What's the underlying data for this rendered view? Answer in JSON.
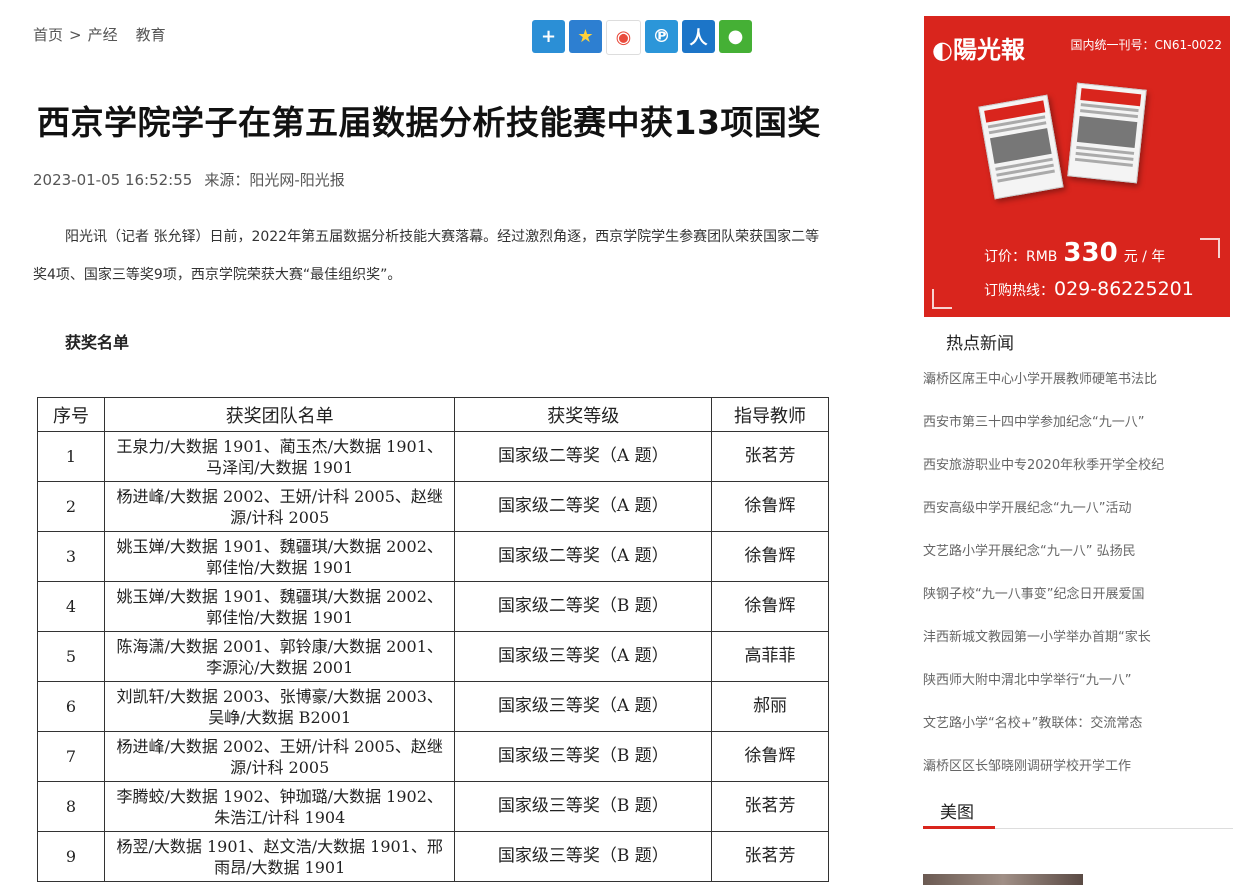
{
  "breadcrumb": {
    "home": "首页",
    "separator": ">",
    "section": "产经",
    "subsection": "教育"
  },
  "share": [
    {
      "icon": "plus-icon",
      "color": "#2b8fd6"
    },
    {
      "icon": "qzone-star-icon",
      "color": "#2d7fd1"
    },
    {
      "icon": "weibo-icon",
      "color": "#e94b3c"
    },
    {
      "icon": "tencent-weibo-icon",
      "color": "#2b96d9"
    },
    {
      "icon": "renren-icon",
      "color": "#1c75c8"
    },
    {
      "icon": "wechat-icon",
      "color": "#45b035"
    }
  ],
  "article": {
    "title": "西京学院学子在第五届数据分析技能赛中获13项国奖",
    "datetime": "2023-01-05 16:52:55",
    "source": "来源：阳光网-阳光报",
    "lead": "阳光讯（记者 张允铎）日前，2022年第五届数据分析技能大赛落幕。经过激烈角逐，西京学院学生参赛团队荣获国家二等奖4项、国家三等奖9项，西京学院荣获大赛“最佳组织奖”。",
    "subheading": "获奖名单"
  },
  "award_table": {
    "headers": [
      "序号",
      "获奖团队名单",
      "获奖等级",
      "指导教师"
    ],
    "rows": [
      {
        "no": "1",
        "team": "王泉力/大数据 1901、蔺玉杰/大数据 1901、马泽闰/大数据 1901",
        "level": "国家级二等奖（A 题）",
        "teacher": "张茗芳"
      },
      {
        "no": "2",
        "team": "杨进峰/大数据 2002、王妍/计科 2005、赵继源/计科 2005",
        "level": "国家级二等奖（A 题）",
        "teacher": "徐鲁辉"
      },
      {
        "no": "3",
        "team": "姚玉婵/大数据 1901、魏疆琪/大数据 2002、郭佳怡/大数据 1901",
        "level": "国家级二等奖（A 题）",
        "teacher": "徐鲁辉"
      },
      {
        "no": "4",
        "team": "姚玉婵/大数据 1901、魏疆琪/大数据 2002、郭佳怡/大数据 1901",
        "level": "国家级二等奖（B 题）",
        "teacher": "徐鲁辉"
      },
      {
        "no": "5",
        "team": "陈海潇/大数据 2001、郭铃康/大数据 2001、李源沁/大数据 2001",
        "level": "国家级三等奖（A 题）",
        "teacher": "高菲菲"
      },
      {
        "no": "6",
        "team": "刘凯轩/大数据 2003、张博豪/大数据 2003、吴峥/大数据 B2001",
        "level": "国家级三等奖（A 题）",
        "teacher": "郝丽"
      },
      {
        "no": "7",
        "team": "杨进峰/大数据 2002、王妍/计科 2005、赵继源/计科 2005",
        "level": "国家级三等奖（B 题）",
        "teacher": "徐鲁辉"
      },
      {
        "no": "8",
        "team": "李腾蛟/大数据 1902、钟珈璐/大数据 1902、朱浩江/计科 1904",
        "level": "国家级三等奖（B 题）",
        "teacher": "张茗芳"
      },
      {
        "no": "9",
        "team": "杨翌/大数据 1901、赵文浩/大数据 1901、邢雨昂/大数据 1901",
        "level": "国家级三等奖（B 题）",
        "teacher": "张茗芳"
      }
    ]
  },
  "sidebar": {
    "ad": {
      "logo": "◐陽光報",
      "issn": "国内统一刊号：CN61-0022",
      "price_prefix": "订价：RMB",
      "price_value": "330",
      "price_suffix": "元 / 年",
      "hotline_label": "订购热线：",
      "hotline_number": "029-86225201"
    },
    "hot_news_title": "热点新闻",
    "hot_news": [
      "灞桥区席王中心小学开展教师硬笔书法比",
      "西安市第三十四中学参加纪念“九一八”",
      "西安旅游职业中专2020年秋季开学全校纪",
      "西安高级中学开展纪念“九一八”活动",
      "文艺路小学开展纪念“九一八” 弘扬民",
      "陕钢子校“九一八事变”纪念日开展爱国",
      "沣西新城文教园第一小学举办首期“家长",
      "陕西师大附中渭北中学举行“九一八”",
      "文艺路小学“名校+”教联体：交流常态",
      "灞桥区区长邹晓刚调研学校开学工作"
    ],
    "photos_title": "美图"
  }
}
